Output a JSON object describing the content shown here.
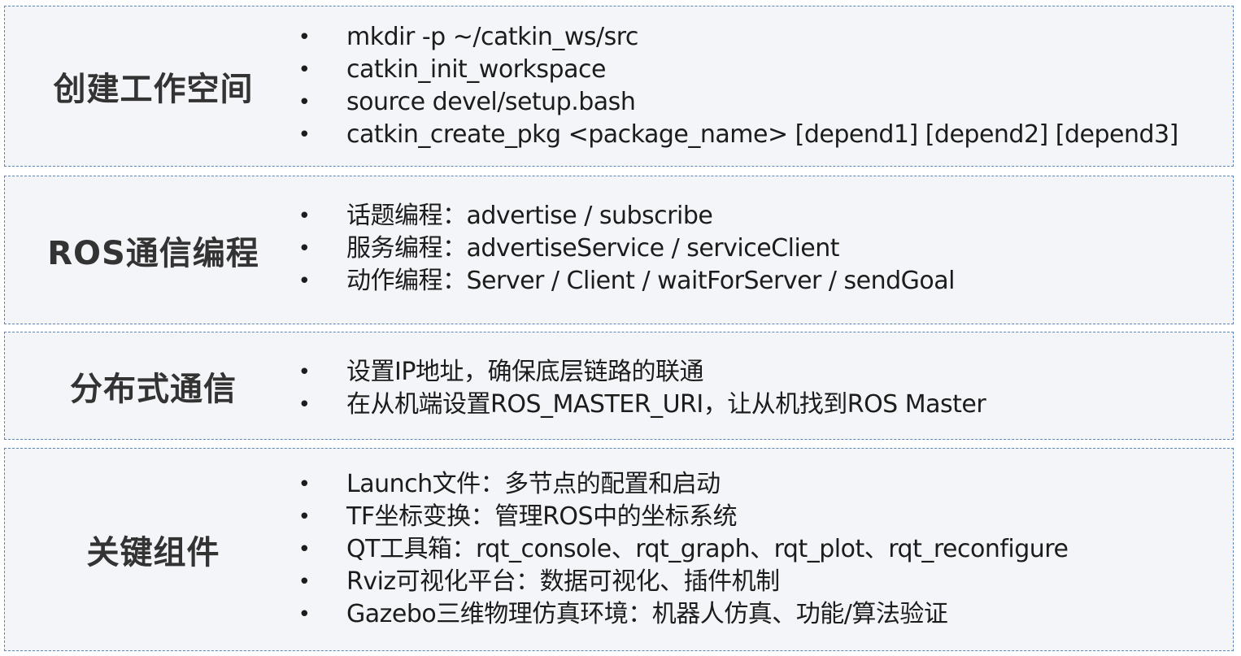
{
  "sections": [
    {
      "title": "创建工作空间",
      "items": [
        "mkdir -p ~/catkin_ws/src",
        "catkin_init_workspace",
        "source devel/setup.bash",
        "catkin_create_pkg <package_name> [depend1] [depend2] [depend3]"
      ]
    },
    {
      "title": "ROS通信编程",
      "items": [
        "话题编程：advertise / subscribe",
        "服务编程：advertiseService / serviceClient",
        "动作编程：Server / Client / waitForServer / sendGoal"
      ]
    },
    {
      "title": "分布式通信",
      "items": [
        "设置IP地址，确保底层链路的联通",
        "在从机端设置ROS_MASTER_URI，让从机找到ROS Master"
      ]
    },
    {
      "title": "关键组件",
      "items": [
        "Launch文件：多节点的配置和启动",
        "TF坐标变换：管理ROS中的坐标系统",
        "QT工具箱：rqt_console、rqt_graph、rqt_plot、rqt_reconfigure",
        "Rviz可视化平台：数据可视化、插件机制",
        "Gazebo三维物理仿真环境：机器人仿真、功能/算法验证"
      ]
    }
  ],
  "bullet_glyph": "•",
  "colors": {
    "border": "#5b86b8",
    "background": "#f4f5f8",
    "title_text": "#333333",
    "item_text": "#1c1c1c"
  }
}
